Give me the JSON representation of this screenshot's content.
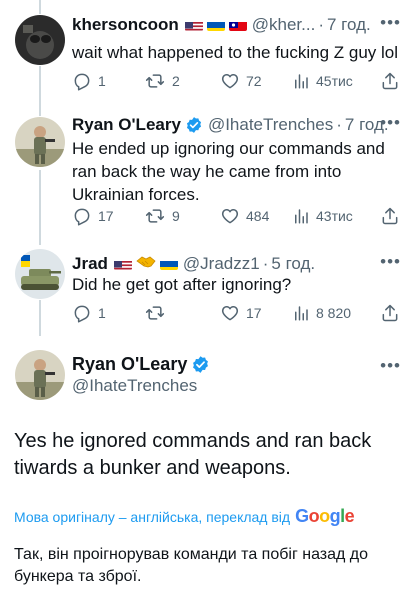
{
  "replies": [
    {
      "name": "khersoncoon",
      "handle": "@kher...",
      "time": "7 год.",
      "text": "wait what happened to the fucking Z guy lol",
      "stats": {
        "replies": "1",
        "retweets": "2",
        "likes": "72",
        "views": "45тис"
      }
    },
    {
      "name": "Ryan O'Leary",
      "handle": "@IhateTrenches",
      "time": "7 год.",
      "text": "He ended up ignoring our commands and ran back the way he came from into Ukrainian forces.",
      "stats": {
        "replies": "17",
        "retweets": "9",
        "likes": "484",
        "views": "43тис"
      }
    },
    {
      "name": "Jrad",
      "handle": "@Jradzz1",
      "time": "5 год.",
      "text": "Did he get got after ignoring?",
      "stats": {
        "replies": "1",
        "retweets": "",
        "likes": "17",
        "views": "8 820"
      }
    }
  ],
  "main_tweet": {
    "name": "Ryan O'Leary",
    "handle": "@IhateTrenches",
    "text": "Yes he ignored commands and ran back tiwards a bunker and weapons.",
    "translation_label": "Мова оригіналу – англійська, переклад від",
    "translation_provider": "Google",
    "translated_text": "Так, він проігнорував команди та побіг назад до бункера та зброї."
  },
  "colors": {
    "accent": "#1d9bf0",
    "muted": "#536471",
    "text": "#0f1419",
    "line": "#cfd9de"
  },
  "icons": [
    "reply-icon",
    "retweet-icon",
    "like-icon",
    "views-icon",
    "share-icon",
    "verified-icon",
    "more-icon"
  ]
}
